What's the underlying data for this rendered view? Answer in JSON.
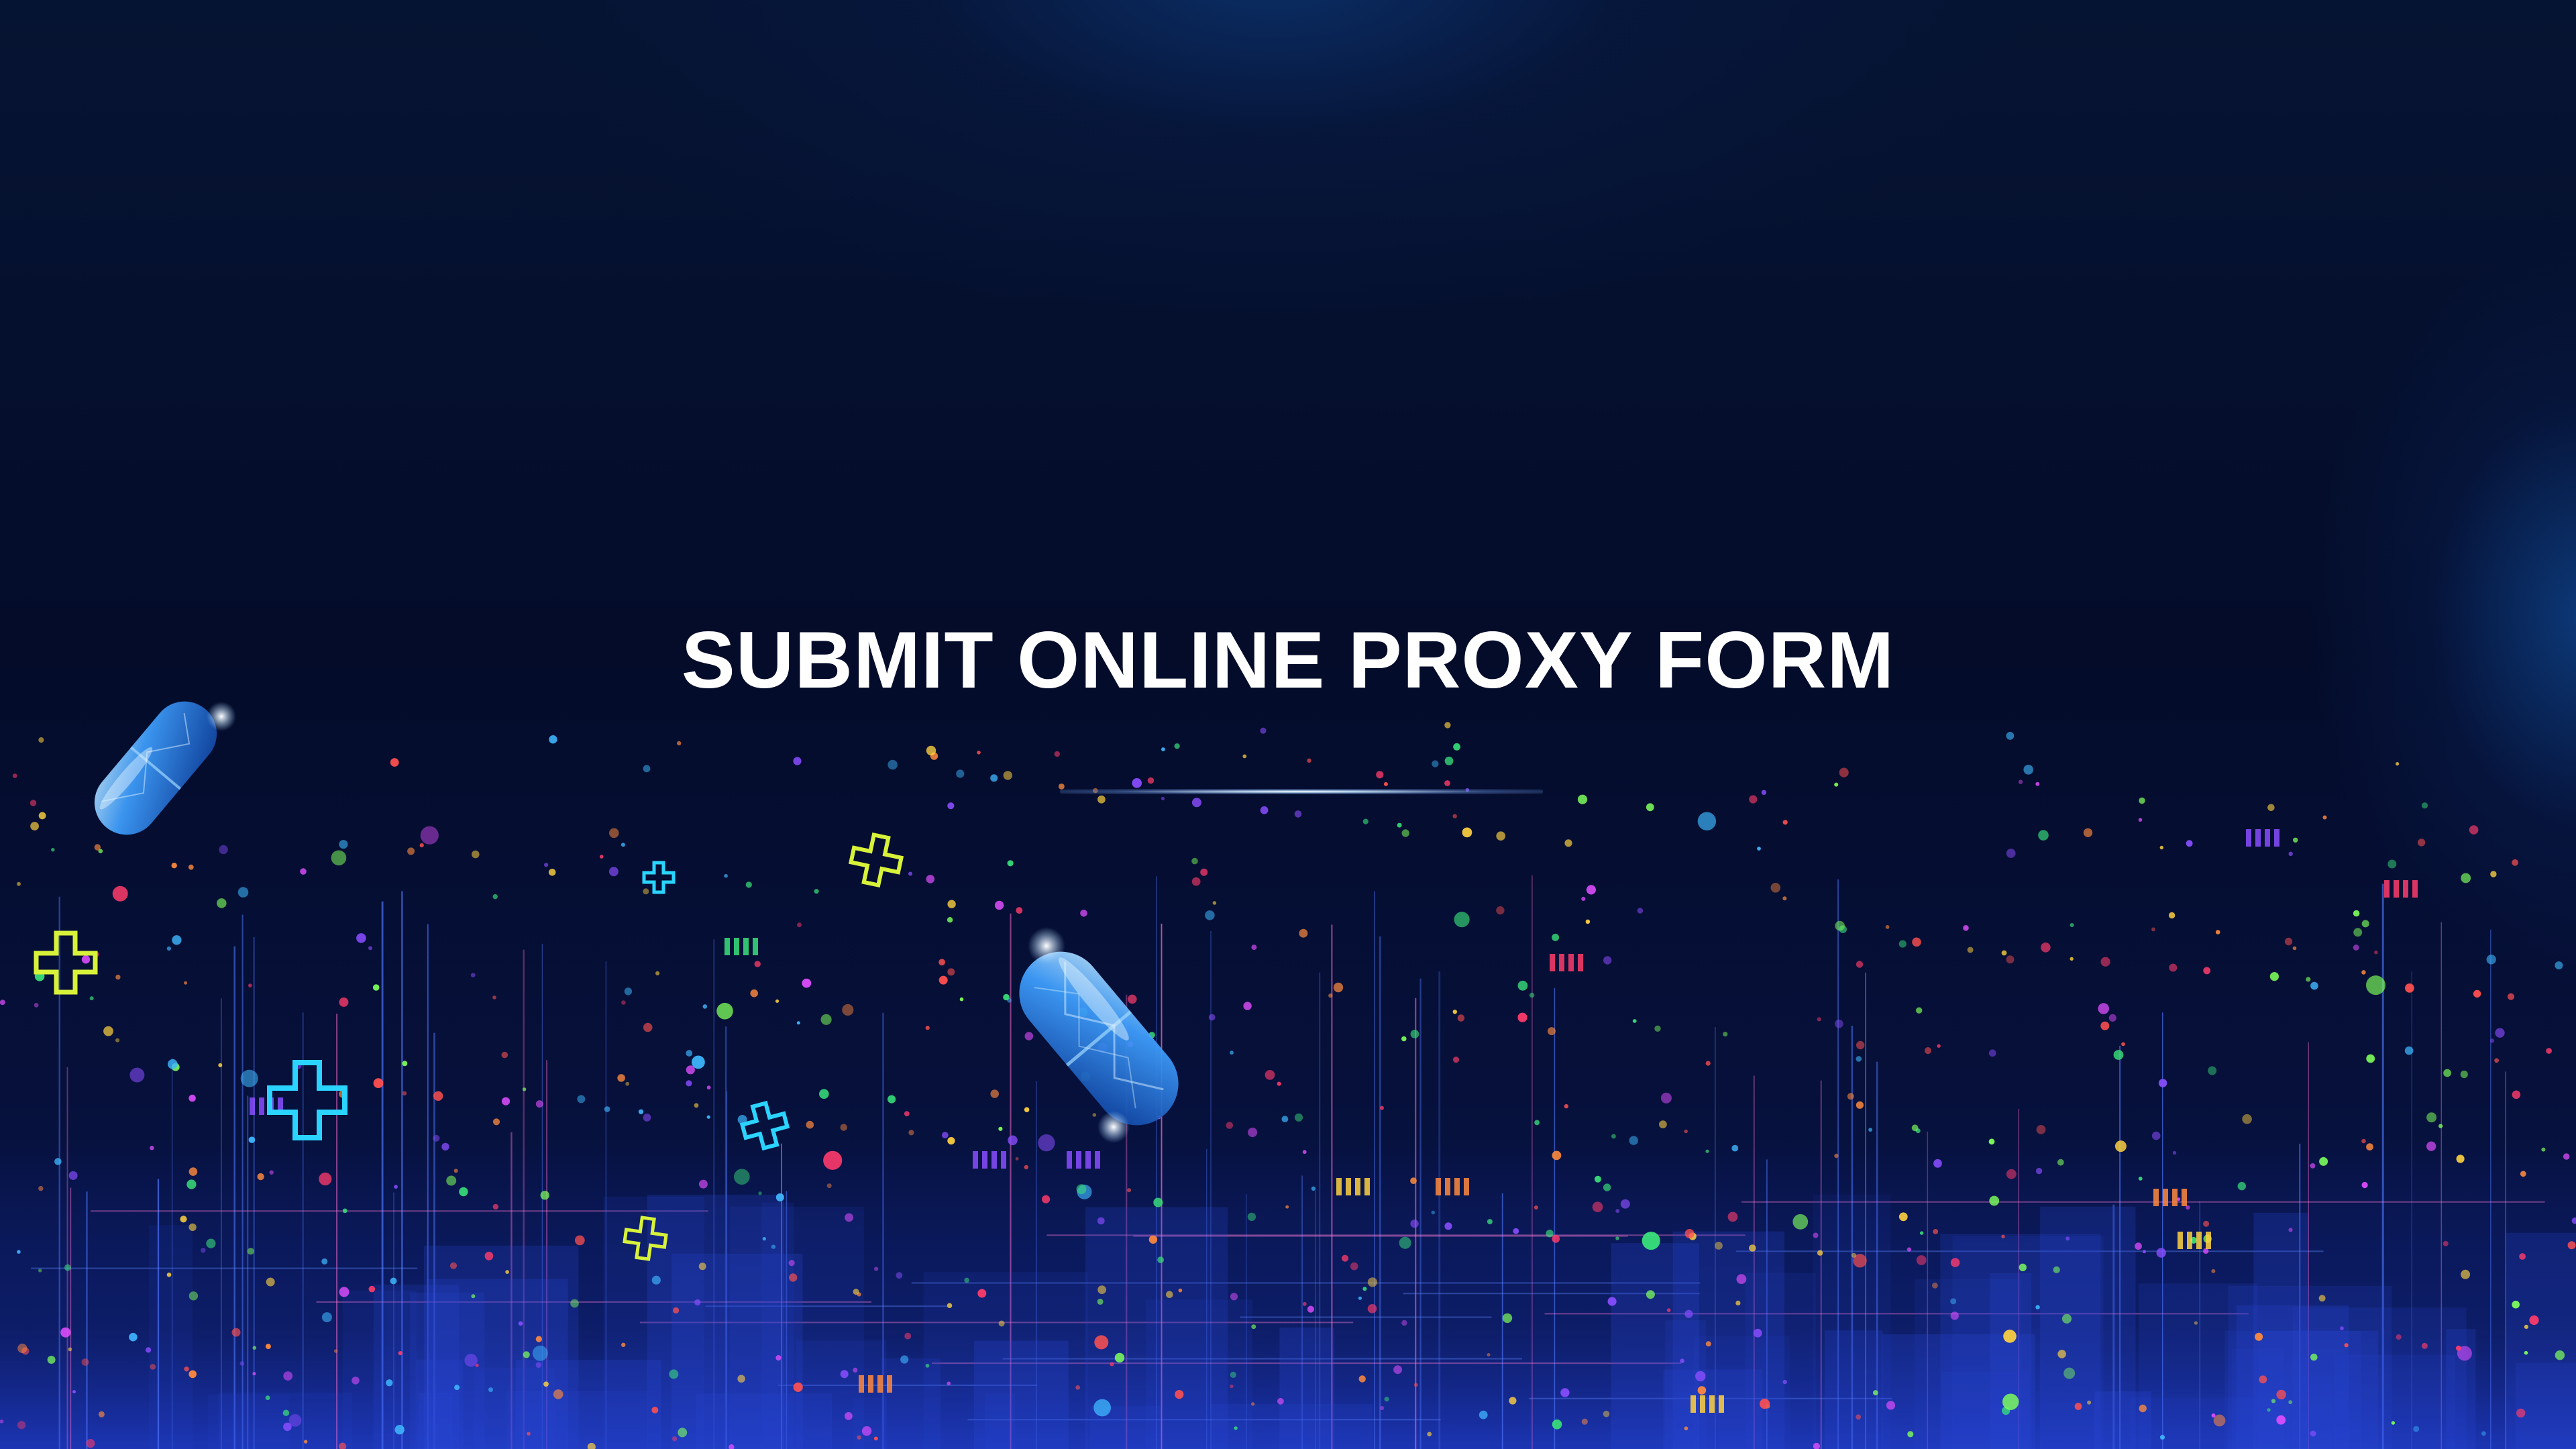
{
  "slide": {
    "title": "SUBMIT ONLINE PROXY FORM"
  },
  "decor": {
    "icons": [
      "capsule-icon",
      "medical-cross-icon"
    ],
    "colors": {
      "background": "#040c2a",
      "title": "#ffffff",
      "capsule": "#2f8df0",
      "cross_cyan": "#2ad4ff",
      "cross_yellow": "#d8f23a",
      "grid_lines": "#3a5cff"
    }
  }
}
